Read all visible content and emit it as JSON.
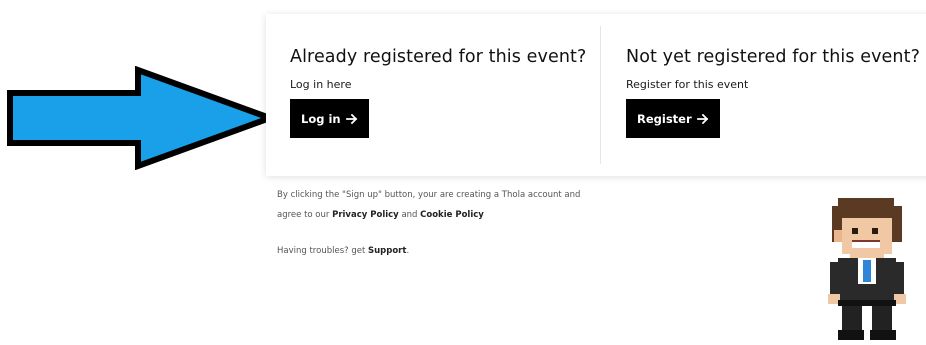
{
  "login": {
    "heading": "Already registered for this event?",
    "subtext": "Log in here",
    "button_label": "Log in",
    "button_icon": "arrow-right-icon"
  },
  "register": {
    "heading": "Not yet registered for this event?",
    "subtext": "Register for this event",
    "button_label": "Register",
    "button_icon": "arrow-right-icon"
  },
  "legal": {
    "text_before": "By clicking the \"Sign up\" button, your are creating a Thola account and agree to our",
    "privacy_label": "Privacy Policy",
    "and_text": "and",
    "cookie_label": "Cookie Policy"
  },
  "help": {
    "text": "Having troubles? get",
    "support_label": "Support",
    "period": "."
  },
  "colors": {
    "button_bg": "#000000",
    "button_text": "#ffffff",
    "annotation_arrow": "#1aa0e8"
  },
  "annotation": {
    "icon": "blue-arrow-icon"
  },
  "mascot": {
    "icon": "pixel-mascot-icon"
  }
}
